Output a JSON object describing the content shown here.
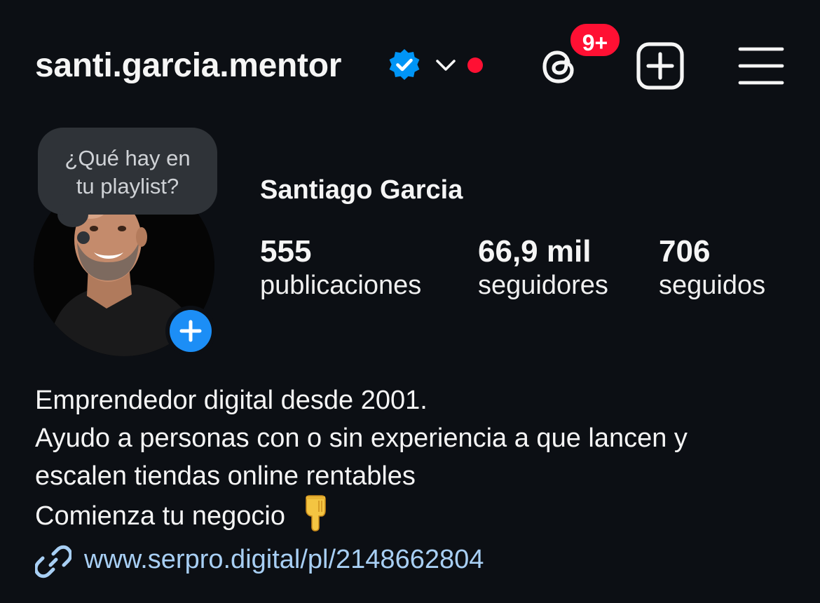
{
  "header": {
    "username": "santi.garcia.mentor",
    "threads_badge": "9+"
  },
  "icons": {
    "verified": "verified-badge-icon",
    "chevron": "chevron-down-icon",
    "threads": "threads-icon",
    "new_post": "plus-square-icon",
    "menu": "hamburger-menu-icon",
    "add_story": "plus-icon",
    "link": "link-icon",
    "emoji": "backhand-index-pointing-down-emoji"
  },
  "colors": {
    "background": "#0c0f14",
    "badge_red": "#ff1033",
    "verified_blue": "#0095f6",
    "link_blue": "#a8cff4",
    "note_bubble": "#2f3338"
  },
  "note": {
    "line1": "¿Qué hay en",
    "line2": "tu playlist?"
  },
  "profile": {
    "display_name": "Santiago Garcia",
    "stats": {
      "posts": {
        "value": "555",
        "label": "publicaciones"
      },
      "followers": {
        "value": "66,9 mil",
        "label": "seguidores"
      },
      "following": {
        "value": "706",
        "label": "seguidos"
      }
    },
    "bio": {
      "line1": "Emprendedor digital desde 2001.",
      "line2": "Ayudo a personas con o sin experiencia a que lancen y",
      "line3": "escalen tiendas online rentables",
      "line4": "Comienza tu negocio"
    },
    "link": "www.serpro.digital/pl/2148662804"
  }
}
